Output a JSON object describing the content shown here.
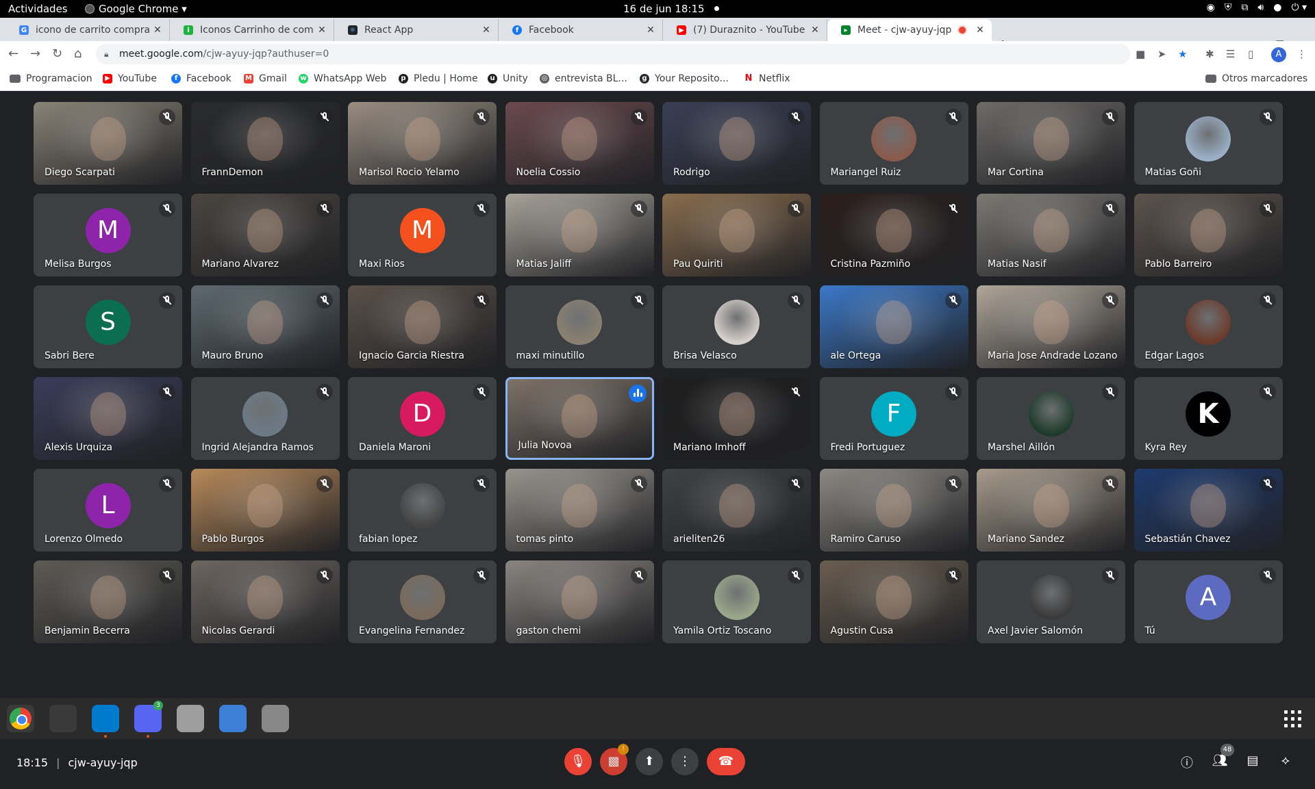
{
  "topbar": {
    "activities": "Actividades",
    "app_name": "Google Chrome",
    "clock": "16 de jun  18:15"
  },
  "tabs": [
    {
      "title": "icono de carrito compras",
      "favicon": "google-icon",
      "color": "#4285f4"
    },
    {
      "title": "Iconos Carrinho de compr",
      "favicon": "icons8-icon",
      "color": "#1fb141"
    },
    {
      "title": "React App",
      "favicon": "react-icon",
      "color": "#20232a"
    },
    {
      "title": "Facebook",
      "favicon": "facebook-icon",
      "color": "#1877f2"
    },
    {
      "title": "(7) Duraznito - YouTube",
      "favicon": "youtube-icon",
      "color": "#ff0000"
    },
    {
      "title": "Meet - cjw-ayuy-jqp",
      "favicon": "meet-icon",
      "color": "#00832d"
    }
  ],
  "address_bar": {
    "url_host": "meet.google.com",
    "url_path": "/cjw-ayuy-jqp?authuser=0"
  },
  "bookmarks": [
    {
      "label": "Programacion",
      "icon": "folder-icon",
      "color": "#5f6368"
    },
    {
      "label": "YouTube",
      "icon": "youtube-icon",
      "color": "#ff0000"
    },
    {
      "label": "Facebook",
      "icon": "facebook-icon",
      "color": "#1877f2"
    },
    {
      "label": "Gmail",
      "icon": "gmail-icon",
      "color": "#ea4335"
    },
    {
      "label": "WhatsApp Web",
      "icon": "whatsapp-icon",
      "color": "#25d366"
    },
    {
      "label": "Pledu | Home",
      "icon": "pledu-icon",
      "color": "#202124"
    },
    {
      "label": "Unity",
      "icon": "unity-icon",
      "color": "#222222"
    },
    {
      "label": "entrevista BL...",
      "icon": "globe-icon",
      "color": "#5f6368"
    },
    {
      "label": "Your Reposito...",
      "icon": "github-icon",
      "color": "#24292e"
    },
    {
      "label": "Netflix",
      "icon": "netflix-icon",
      "color": "#e50914"
    }
  ],
  "other_bookmarks": "Otros marcadores",
  "participants": [
    {
      "name": "Diego Scarpati",
      "bg": "#8a8377"
    },
    {
      "name": "FrannDemon",
      "bg": "#2a2b2c"
    },
    {
      "name": "Marisol Rocio Yelamo",
      "bg": "#9a8e82"
    },
    {
      "name": "Noelia Cossio",
      "bg": "#6b4a4e"
    },
    {
      "name": "Rodrigo",
      "bg": "#3a3f55"
    },
    {
      "name": "Mariangel Ruiz",
      "photo": "#8b5a4a"
    },
    {
      "name": "Mar Cortina",
      "bg": "#6e6b68"
    },
    {
      "name": "Matias Goñi",
      "photo": "#9ab0c8"
    },
    {
      "name": "Melisa Burgos",
      "letter": "M",
      "color": "#8e24aa"
    },
    {
      "name": "Mariano Alvarez",
      "bg": "#4a4540"
    },
    {
      "name": "Maxi Rios",
      "letter": "M",
      "color": "#f4511e"
    },
    {
      "name": "Matias Jaliff",
      "bg": "#a8a39a"
    },
    {
      "name": "Pau Quiriti",
      "bg": "#8a6d4e"
    },
    {
      "name": "Cristina Pazmiño",
      "bg": "#2b1f1c"
    },
    {
      "name": "Matias Nasif",
      "bg": "#7d7a75"
    },
    {
      "name": "Pablo Barreiro",
      "bg": "#5c534c"
    },
    {
      "name": "Sabri Bere",
      "letter": "S",
      "color": "#0b6e4f"
    },
    {
      "name": "Mauro Bruno",
      "bg": "#5e6a70"
    },
    {
      "name": "Ignacio Garcia Riestra",
      "bg": "#5a5048"
    },
    {
      "name": "maxi minutillo",
      "photo": "#8a8070"
    },
    {
      "name": "Brisa Velasco",
      "photo": "#d8d0cc"
    },
    {
      "name": "ale Ortega",
      "bg": "#3b79c9"
    },
    {
      "name": "Maria Jose Andrade Lozano",
      "bg": "#b0a69a"
    },
    {
      "name": "Edgar Lagos",
      "photo": "#6b3a2a"
    },
    {
      "name": "Alexis Urquiza",
      "bg": "#3a3d5a"
    },
    {
      "name": "Ingrid Alejandra Ramos",
      "photo": "#6c7a86"
    },
    {
      "name": "Daniela Maroni",
      "letter": "D",
      "color": "#d81b60"
    },
    {
      "name": "Julia Novoa",
      "bg": "#7e7268",
      "speaking": true
    },
    {
      "name": "Mariano Imhoff",
      "bg": "#1e1e1e"
    },
    {
      "name": "Fredi Portuguez",
      "letter": "F",
      "color": "#00acc1"
    },
    {
      "name": "Marshel Aillón",
      "photo": "#1d3b2a"
    },
    {
      "name": "Kyra Rey",
      "photo": "#000000",
      "photo_letter": "K"
    },
    {
      "name": "Lorenzo Olmedo",
      "letter": "L",
      "color": "#8e24aa"
    },
    {
      "name": "Pablo Burgos",
      "bg": "#b88a5a"
    },
    {
      "name": "fabian lopez",
      "photo": "#444444"
    },
    {
      "name": "tomas pinto",
      "bg": "#9a958e"
    },
    {
      "name": "arieliten26",
      "bg": "#3f4245"
    },
    {
      "name": "Ramiro Caruso",
      "bg": "#8d8a84"
    },
    {
      "name": "Mariano Sandez",
      "bg": "#a79b8c"
    },
    {
      "name": "Sebastián Chavez",
      "bg": "#1e3a6e"
    },
    {
      "name": "Benjamin Becerra",
      "bg": "#5e5b55"
    },
    {
      "name": "Nicolas Gerardi",
      "bg": "#6d6660"
    },
    {
      "name": "Evangelina Fernandez",
      "photo": "#7a6a5a"
    },
    {
      "name": "gaston chemi",
      "bg": "#8a8580"
    },
    {
      "name": "Yamila Ortiz Toscano",
      "photo": "#9aa88a"
    },
    {
      "name": "Agustin Cusa",
      "bg": "#6a5e50"
    },
    {
      "name": "Axel Javier Salomón",
      "photo": "#3a3a3a"
    },
    {
      "name": "Tú",
      "letter": "A",
      "color": "#5c6bc0"
    }
  ],
  "meeting": {
    "time": "18:15",
    "code": "cjw-ayuy-jqp",
    "people_count": "48"
  },
  "dock": [
    {
      "name": "chrome-icon",
      "color": "#4285f4"
    },
    {
      "name": "terminal-icon",
      "color": "#3a3a3a"
    },
    {
      "name": "vscode-icon",
      "color": "#007acc"
    },
    {
      "name": "discord-icon",
      "color": "#5865f2",
      "badge": "3"
    },
    {
      "name": "files-icon",
      "color": "#9e9e9e"
    },
    {
      "name": "text-editor-icon",
      "color": "#3d7fd6"
    },
    {
      "name": "image-viewer-icon",
      "color": "#888888"
    }
  ]
}
